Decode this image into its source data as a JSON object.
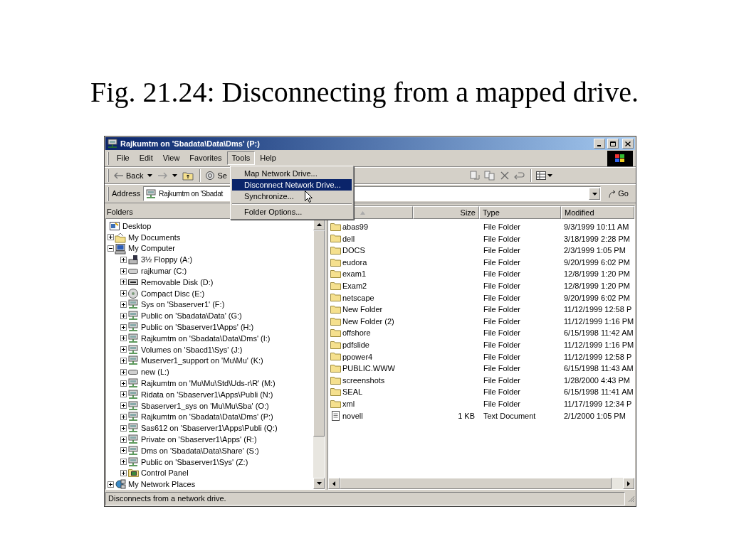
{
  "caption": "Fig. 21.24: Disconnecting from a mapped drive.",
  "window": {
    "title": "Rajkumtm on 'Sbadata\\Data\\Dms' (P:)"
  },
  "menu_bar": [
    {
      "label": "File",
      "open": false
    },
    {
      "label": "Edit",
      "open": false
    },
    {
      "label": "View",
      "open": false
    },
    {
      "label": "Favorites",
      "open": false
    },
    {
      "label": "Tools",
      "open": true
    },
    {
      "label": "Help",
      "open": false
    }
  ],
  "toolbar": {
    "back": "Back",
    "search": "Se"
  },
  "address": {
    "label": "Address",
    "value": "Rajkumtm on 'Sbadat",
    "go": "Go"
  },
  "tools_menu": [
    {
      "label": "Map Network Drive...",
      "selected": false,
      "separator_before": false
    },
    {
      "label": "Disconnect Network Drive...",
      "selected": true,
      "separator_before": false
    },
    {
      "label": "Synchronize...",
      "selected": false,
      "separator_before": false
    },
    {
      "label": "Folder Options...",
      "selected": false,
      "separator_before": true
    }
  ],
  "folders": {
    "title": "Folders",
    "tree": [
      {
        "label": "Desktop",
        "kind": "desktop",
        "children": [
          {
            "label": "My Documents",
            "kind": "documents",
            "expanded": false
          },
          {
            "label": "My Computer",
            "kind": "computer",
            "expanded": true,
            "children": [
              {
                "label": "3½ Floppy (A:)",
                "kind": "floppy",
                "expanded": false
              },
              {
                "label": "rajkumar (C:)",
                "kind": "drive",
                "expanded": false
              },
              {
                "label": "Removable Disk (D:)",
                "kind": "removable",
                "expanded": false
              },
              {
                "label": "Compact Disc (E:)",
                "kind": "cd",
                "expanded": false
              },
              {
                "label": "Sys on 'Sbaserver1' (F:)",
                "kind": "network",
                "expanded": false
              },
              {
                "label": "Public on 'Sbadata\\Data' (G:)",
                "kind": "network",
                "expanded": false
              },
              {
                "label": "Public on 'Sbaserver1\\Apps' (H:)",
                "kind": "network",
                "expanded": false
              },
              {
                "label": "Rajkumtm on 'Sbadata\\Data\\Dms' (I:)",
                "kind": "network",
                "expanded": false
              },
              {
                "label": "Volumes on 'Sbacd1\\Sys' (J:)",
                "kind": "network",
                "expanded": false
              },
              {
                "label": "Muserver1_support on 'Mu\\Mu' (K:)",
                "kind": "network",
                "expanded": false
              },
              {
                "label": "new (L:)",
                "kind": "drive",
                "expanded": false
              },
              {
                "label": "Rajkumtm on 'Mu\\Mu\\Std\\Uds-r\\R' (M:)",
                "kind": "network",
                "expanded": false
              },
              {
                "label": "Ridata on 'Sbaserver1\\Apps\\Publi (N:)",
                "kind": "network",
                "expanded": false
              },
              {
                "label": "Sbaserver1_sys on 'Mu\\Mu\\Sba' (O:)",
                "kind": "network",
                "expanded": false
              },
              {
                "label": "Rajkumtm on 'Sbadata\\Data\\Dms' (P:)",
                "kind": "network",
                "expanded": false
              },
              {
                "label": "Sas612 on 'Sbaserver1\\Apps\\Publi (Q:)",
                "kind": "network",
                "expanded": false
              },
              {
                "label": "Private on 'Sbaserver1\\Apps' (R:)",
                "kind": "network",
                "expanded": false
              },
              {
                "label": "Dms on 'Sbadata\\Data\\Share' (S:)",
                "kind": "network",
                "expanded": false
              },
              {
                "label": "Public on 'Sbaserver1\\Sys' (Z:)",
                "kind": "network",
                "expanded": false
              },
              {
                "label": "Control Panel",
                "kind": "control",
                "expanded": false
              }
            ]
          },
          {
            "label": "My Network Places",
            "kind": "places",
            "expanded": false
          }
        ]
      }
    ]
  },
  "files": {
    "columns": [
      "Size",
      "Type",
      "Modified"
    ],
    "rows": [
      {
        "name": "abas99",
        "kind": "folder",
        "type": "File Folder",
        "modified": "9/3/1999 10:11 AM"
      },
      {
        "name": "dell",
        "kind": "folder",
        "type": "File Folder",
        "modified": "3/18/1999 2:28 PM"
      },
      {
        "name": "DOCS",
        "kind": "folder",
        "type": "File Folder",
        "modified": "2/3/1999 1:05 PM"
      },
      {
        "name": "eudora",
        "kind": "folder",
        "type": "File Folder",
        "modified": "9/20/1999 6:02 PM"
      },
      {
        "name": "exam1",
        "kind": "folder",
        "type": "File Folder",
        "modified": "12/8/1999 1:20 PM"
      },
      {
        "name": "Exam2",
        "kind": "folder",
        "type": "File Folder",
        "modified": "12/8/1999 1:20 PM"
      },
      {
        "name": "netscape",
        "kind": "folder",
        "type": "File Folder",
        "modified": "9/20/1999 6:02 PM"
      },
      {
        "name": "New Folder",
        "kind": "folder",
        "type": "File Folder",
        "modified": "11/12/1999 12:58 P"
      },
      {
        "name": "New Folder (2)",
        "kind": "folder",
        "type": "File Folder",
        "modified": "11/12/1999 1:16 PM"
      },
      {
        "name": "offshore",
        "kind": "folder",
        "type": "File Folder",
        "modified": "6/15/1998 11:42 AM"
      },
      {
        "name": "pdfslide",
        "kind": "folder",
        "type": "File Folder",
        "modified": "11/12/1999 1:16 PM"
      },
      {
        "name": "ppower4",
        "kind": "folder",
        "type": "File Folder",
        "modified": "11/12/1999 12:58 P"
      },
      {
        "name": "PUBLIC.WWW",
        "kind": "folder",
        "type": "File Folder",
        "modified": "6/15/1998 11:43 AM"
      },
      {
        "name": "screenshots",
        "kind": "folder",
        "type": "File Folder",
        "modified": "1/28/2000 4:43 PM"
      },
      {
        "name": "SEAL",
        "kind": "folder",
        "type": "File Folder",
        "modified": "6/15/1998 11:41 AM"
      },
      {
        "name": "xml",
        "kind": "folder",
        "type": "File Folder",
        "modified": "11/17/1999 12:34 P"
      },
      {
        "name": "novell",
        "kind": "text",
        "size": "1 KB",
        "type": "Text Document",
        "modified": "2/1/2000 1:05 PM"
      }
    ]
  },
  "status_bar": "Disconnects from a network drive."
}
